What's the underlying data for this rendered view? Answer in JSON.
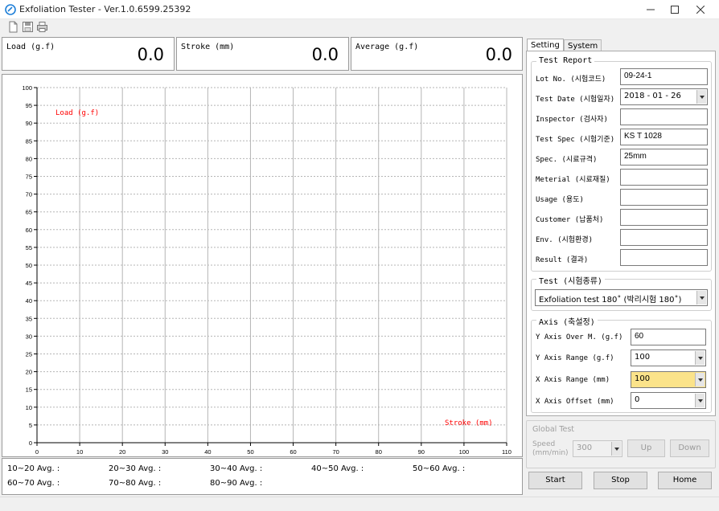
{
  "window": {
    "title": "Exfoliation Tester - Ver.1.0.6599.25392"
  },
  "toolbar": {
    "icons": [
      "new-file-icon",
      "save-icon",
      "print-icon"
    ]
  },
  "readouts": [
    {
      "label": "Load (g.f)",
      "value": "0.0"
    },
    {
      "label": "Stroke (mm)",
      "value": "0.0"
    },
    {
      "label": "Average (g.f)",
      "value": "0.0"
    }
  ],
  "chart_data": {
    "type": "line",
    "series_label": "Load (g.f)",
    "xlabel": "Stroke (mm)",
    "xlim": [
      0,
      110
    ],
    "ylim": [
      0,
      100
    ],
    "x_ticks": [
      "0",
      "10",
      "20",
      "30",
      "40",
      "50",
      "60",
      "70",
      "80",
      "90",
      "100",
      "110"
    ],
    "y_ticks": [
      "0",
      "5",
      "10",
      "15",
      "20",
      "25",
      "30",
      "35",
      "40",
      "45",
      "50",
      "55",
      "60",
      "65",
      "70",
      "75",
      "80",
      "85",
      "90",
      "95",
      "100"
    ],
    "series": [],
    "grid": true,
    "colors": {
      "label": "#ff0000",
      "grid": "#b5b5b5"
    }
  },
  "averages": {
    "row1": [
      "10~20 Avg. :",
      "20~30 Avg. :",
      "30~40 Avg. :",
      "40~50 Avg. :",
      "50~60 Avg. :"
    ],
    "row2": [
      "60~70 Avg. :",
      "70~80 Avg. :",
      "80~90 Avg. :"
    ]
  },
  "tabs": {
    "setting": "Setting",
    "system": "System"
  },
  "test_report": {
    "title": "Test Report",
    "fields": [
      {
        "label": "Lot No. (시험코드)",
        "value": "09-24-1"
      },
      {
        "label": "Test Date (시험일자)",
        "value": "2018 - 01 - 26"
      },
      {
        "label": "Inspector (검사자)",
        "value": ""
      },
      {
        "label": "Test Spec (시험기준)",
        "value": "KS T 1028"
      },
      {
        "label": "Spec. (시료규격)",
        "value": "25mm"
      },
      {
        "label": "Meterial (시료재질)",
        "value": ""
      },
      {
        "label": "Usage (용도)",
        "value": ""
      },
      {
        "label": "Customer (납품처)",
        "value": ""
      },
      {
        "label": "Env. (시험환경)",
        "value": ""
      },
      {
        "label": "Result (결과)",
        "value": ""
      }
    ]
  },
  "test_type": {
    "title": "Test (시험종류)",
    "selected": "Exfoliation test 180˚ (박리시험 180˚)"
  },
  "axis": {
    "title": "Axis (축설정)",
    "y_over_label": "Y Axis Over M. (g.f)",
    "y_over_value": "60",
    "y_range_label": "Y Axis Range (g.f)",
    "y_range_value": "100",
    "x_range_label": "X Axis Range (mm)",
    "x_range_value": "100",
    "x_offset_label": "X Axis Offset (mm)",
    "x_offset_value": "0"
  },
  "global_test": {
    "title": "Global Test",
    "speed_label_1": "Speed",
    "speed_label_2": "(mm/min)",
    "speed_value": "300",
    "up": "Up",
    "down": "Down"
  },
  "actions": {
    "start": "Start",
    "stop": "Stop",
    "home": "Home"
  }
}
